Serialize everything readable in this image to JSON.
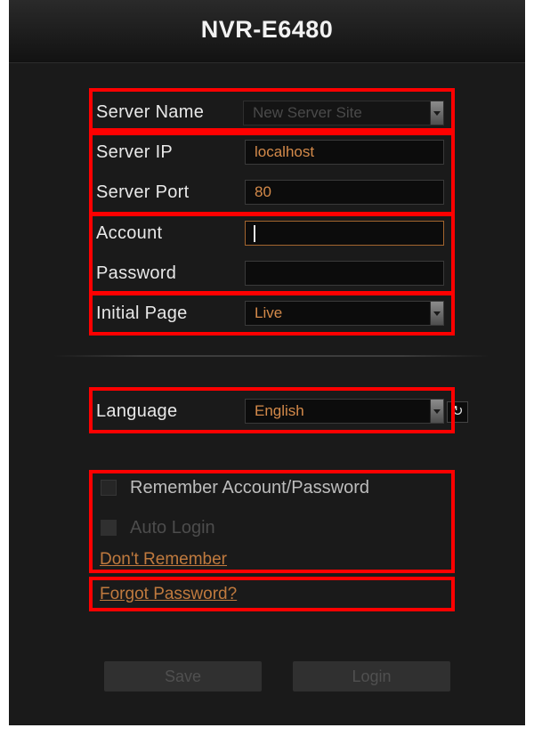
{
  "header": {
    "title": "NVR-E6480"
  },
  "form": {
    "server_name": {
      "label": "Server Name",
      "value": "New Server Site"
    },
    "server_ip": {
      "label": "Server IP",
      "value": "localhost"
    },
    "server_port": {
      "label": "Server Port",
      "value": "80"
    },
    "account": {
      "label": "Account",
      "value": ""
    },
    "password": {
      "label": "Password",
      "value": ""
    },
    "initial_page": {
      "label": "Initial Page",
      "value": "Live"
    },
    "language": {
      "label": "Language",
      "value": "English"
    }
  },
  "options": {
    "remember_label": "Remember Account/Password",
    "auto_login_label": "Auto Login",
    "dont_remember_link": "Don't Remember",
    "forgot_password_link": "Forgot Password?"
  },
  "buttons": {
    "save": "Save",
    "login": "Login"
  },
  "colors": {
    "accent": "#d48a4a",
    "highlight_box": "#ff0000",
    "panel_bg": "#1a1a1a"
  },
  "icons": {
    "refresh": "refresh-icon",
    "dropdown": "chevron-down-icon"
  }
}
